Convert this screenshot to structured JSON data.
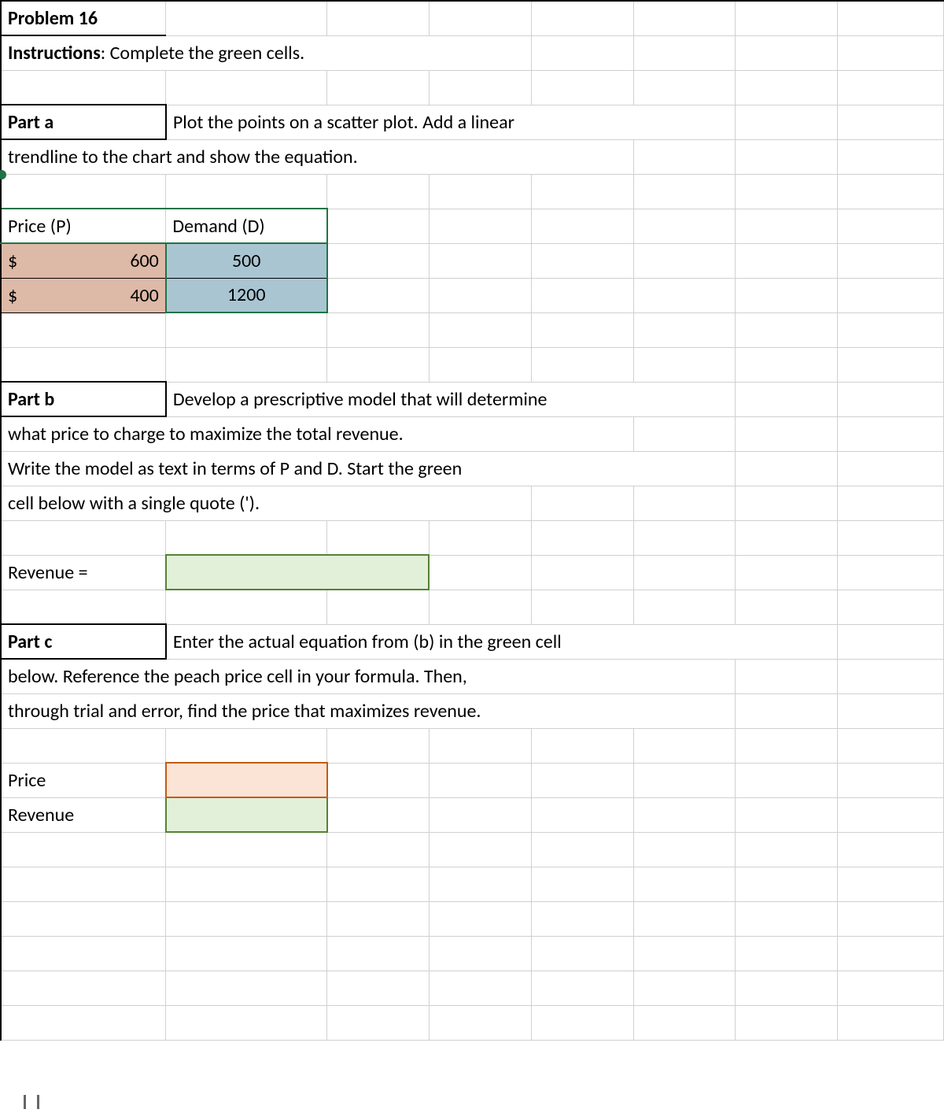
{
  "title": "Problem 16",
  "instructions_label": "Instructions",
  "instructions_text": ": Complete the green cells.",
  "part_a": {
    "label": "Part a",
    "text1": "Plot the points on a scatter plot. Add a linear",
    "text2": "trendline to the chart and show the equation."
  },
  "data_table": {
    "price_header": "Price (P)",
    "demand_header": "Demand (D)",
    "dollar_sign": "$",
    "rows": [
      {
        "price": "600",
        "demand": "500"
      },
      {
        "price": "400",
        "demand": "1200"
      }
    ]
  },
  "part_b": {
    "label": "Part b",
    "text1": "Develop a prescriptive model that will determine",
    "text2": "what price to charge to maximize the total revenue.",
    "text3": "Write the model as text in terms of P and D. Start the green",
    "text4": "cell below with a single quote (').",
    "revenue_label": "Revenue ="
  },
  "part_c": {
    "label": "Part c",
    "text1": "Enter the actual equation from (b) in the green cell",
    "text2": "below. Reference the peach price cell in your formula. Then,",
    "text3": "through trial and error, find the price that maximizes revenue.",
    "price_label": "Price",
    "revenue_label": "Revenue"
  },
  "chart_data": {
    "type": "table",
    "title": "Price vs Demand data points",
    "columns": [
      "Price (P)",
      "Demand (D)"
    ],
    "rows": [
      [
        600,
        500
      ],
      [
        400,
        1200
      ]
    ]
  }
}
